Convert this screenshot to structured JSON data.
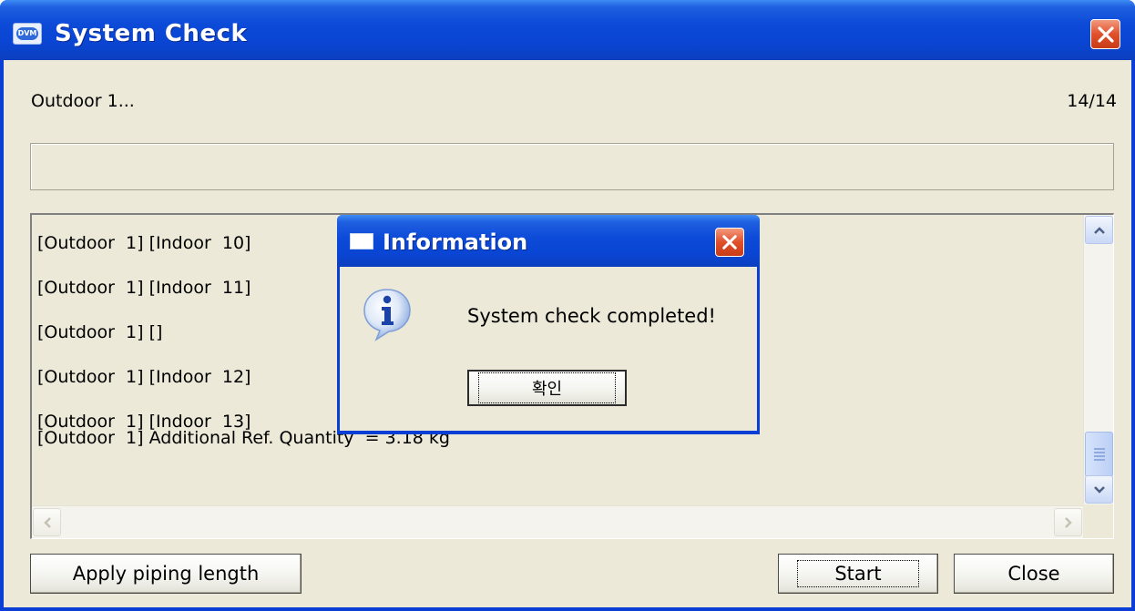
{
  "window": {
    "title": "System Check",
    "app_icon": "dvm-app-icon",
    "close_icon": "close-icon"
  },
  "status": {
    "text": "Outdoor  1...",
    "counter": "14/14"
  },
  "progress": {
    "fraction": 0
  },
  "log": {
    "lines": [
      "[Outdoor  1] [Indoor  10]",
      "[Outdoor  1] [Indoor  11]",
      "[Outdoor  1] []",
      "[Outdoor  1] [Indoor  12]",
      "[Outdoor  1] [Indoor  13]",
      "[Outdoor  1] Additional Ref. Quantity  = 3.18 kg"
    ]
  },
  "buttons": {
    "apply_piping_length": "Apply piping length",
    "start": "Start",
    "close": "Close"
  },
  "dialog": {
    "title": "Information",
    "message": "System check completed!",
    "ok_label": "확인",
    "icon": "info-icon"
  },
  "colors": {
    "titlebar": "#0a45d3",
    "client_bg": "#ece9d8",
    "close_red": "#e0502b"
  }
}
